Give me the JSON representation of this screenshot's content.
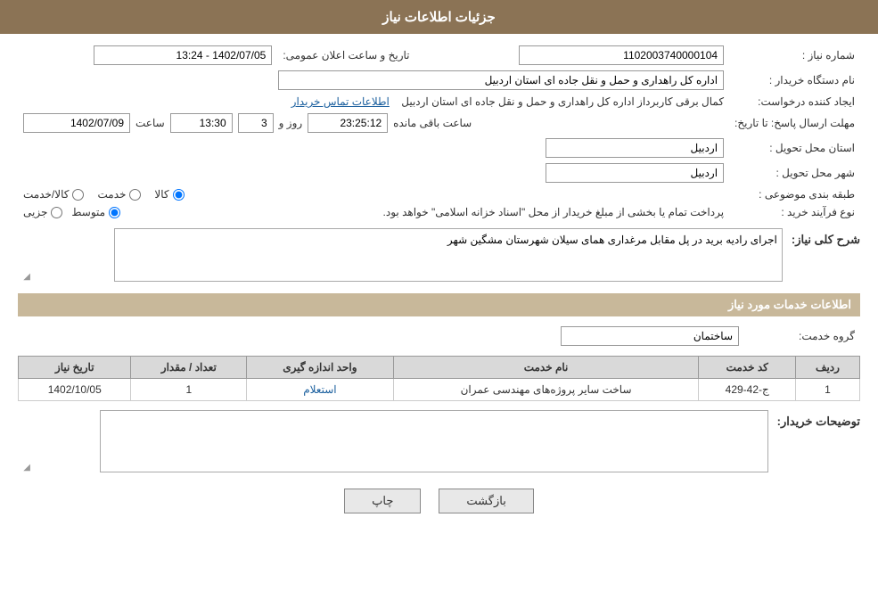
{
  "header": {
    "title": "جزئیات اطلاعات نیاز"
  },
  "labels": {
    "need_number": "شماره نیاز :",
    "buyer_org": "نام دستگاه خریدار :",
    "requester": "ایجاد کننده درخواست:",
    "reply_deadline": "مهلت ارسال پاسخ: تا تاریخ:",
    "delivery_province": "استان محل تحویل :",
    "delivery_city": "شهر محل تحویل :",
    "subject_category": "طبقه بندی موضوعی :",
    "purchase_type": "نوع فرآیند خرید :",
    "need_description_title": "شرح کلی نیاز:",
    "services_title": "اطلاعات خدمات مورد نیاز",
    "service_group": "گروه خدمت:",
    "buyer_notes": "توضیحات خریدار:"
  },
  "values": {
    "need_number": "1102003740000104",
    "buyer_org": "اداره کل راهداری و حمل و نقل جاده ای استان اردبیل",
    "requester": "کمال برقی کاربرداز اداره کل راهداری و حمل و نقل جاده ای استان اردبیل",
    "requester_link": "اطلاعات تماس خریدار",
    "announce_date_label": "تاریخ و ساعت اعلان عمومی:",
    "announce_date": "1402/07/05 - 13:24",
    "deadline_date": "1402/07/09",
    "deadline_time": "13:30",
    "deadline_days": "3",
    "deadline_remaining": "23:25:12",
    "deadline_days_label": "روز و",
    "deadline_remaining_label": "ساعت باقی مانده",
    "delivery_province": "اردبیل",
    "delivery_city": "اردبیل",
    "subject_radio1": "کالا",
    "subject_radio2": "خدمت",
    "subject_radio3": "کالا/خدمت",
    "purchase_radio1": "جزیی",
    "purchase_radio2": "متوسط",
    "purchase_note": "پرداخت تمام یا بخشی از مبلغ خریدار از محل \"اسناد خزانه اسلامی\" خواهد بود.",
    "need_description": "اجرای رادیه برید در پل مقابل مرغداری همای سیلان شهرستان مشگین شهر",
    "service_group_value": "ساختمان",
    "buyer_notes_value": ""
  },
  "services_table": {
    "columns": [
      "ردیف",
      "کد خدمت",
      "نام خدمت",
      "واحد اندازه گیری",
      "تعداد / مقدار",
      "تاریخ نیاز"
    ],
    "rows": [
      {
        "row": "1",
        "service_code": "ج-42-429",
        "service_name": "ساخت سایر پروژه‌های مهندسی عمران",
        "unit": "استعلام",
        "quantity": "1",
        "date": "1402/10/05"
      }
    ]
  },
  "buttons": {
    "print": "چاپ",
    "back": "بازگشت"
  }
}
